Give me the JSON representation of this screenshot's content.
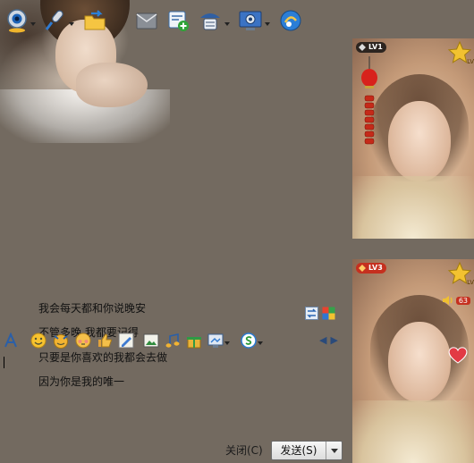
{
  "window": {
    "background_color": "#736a60"
  },
  "toolbar": {
    "buttons": [
      {
        "name": "video-call",
        "icon": "webcam-icon",
        "has_menu": true
      },
      {
        "name": "voice-call",
        "icon": "microphone-icon",
        "has_menu": true
      },
      {
        "name": "send-file",
        "icon": "folder-send-icon",
        "has_menu": false
      },
      {
        "name": "send-sms",
        "icon": "message-icon",
        "has_menu": false
      },
      {
        "name": "create-group",
        "icon": "add-contact-icon",
        "has_menu": false
      },
      {
        "name": "apps",
        "icon": "user-apps-icon",
        "has_menu": true
      },
      {
        "name": "remote-assist",
        "icon": "remote-desktop-icon",
        "has_menu": true
      },
      {
        "name": "music",
        "icon": "music-sync-icon",
        "has_menu": false
      }
    ]
  },
  "peer_panels": {
    "top": {
      "level_label": "LV1",
      "star_label": "LV"
    },
    "bottom": {
      "level_label": "LV3",
      "star_label": "LV",
      "volume_value": "63"
    }
  },
  "messages": [
    {
      "text": "我会每天都和你说晚安"
    },
    {
      "text": "不管多晚 我都要记得"
    },
    {
      "text": "只要是你喜欢的我都会去做"
    },
    {
      "text": "因为你是我的唯一"
    }
  ],
  "format_toolbar": {
    "buttons": [
      {
        "name": "font",
        "icon": "font-icon"
      },
      {
        "name": "emoticons",
        "icon": "smiley-icon"
      },
      {
        "name": "magic-emotion",
        "icon": "magic-face-icon"
      },
      {
        "name": "nudge",
        "icon": "nudge-face-icon"
      },
      {
        "name": "gift",
        "icon": "thumbs-up-icon"
      },
      {
        "name": "doodle",
        "icon": "pen-icon"
      },
      {
        "name": "send-image",
        "icon": "image-icon"
      },
      {
        "name": "music-share",
        "icon": "note-icon"
      },
      {
        "name": "present",
        "icon": "gift-box-icon"
      },
      {
        "name": "screenshot",
        "icon": "screen-capture-icon"
      },
      {
        "name": "payment",
        "icon": "payment-icon"
      }
    ]
  },
  "actions": {
    "close_label": "关闭(C)",
    "send_label": "发送(S)"
  }
}
